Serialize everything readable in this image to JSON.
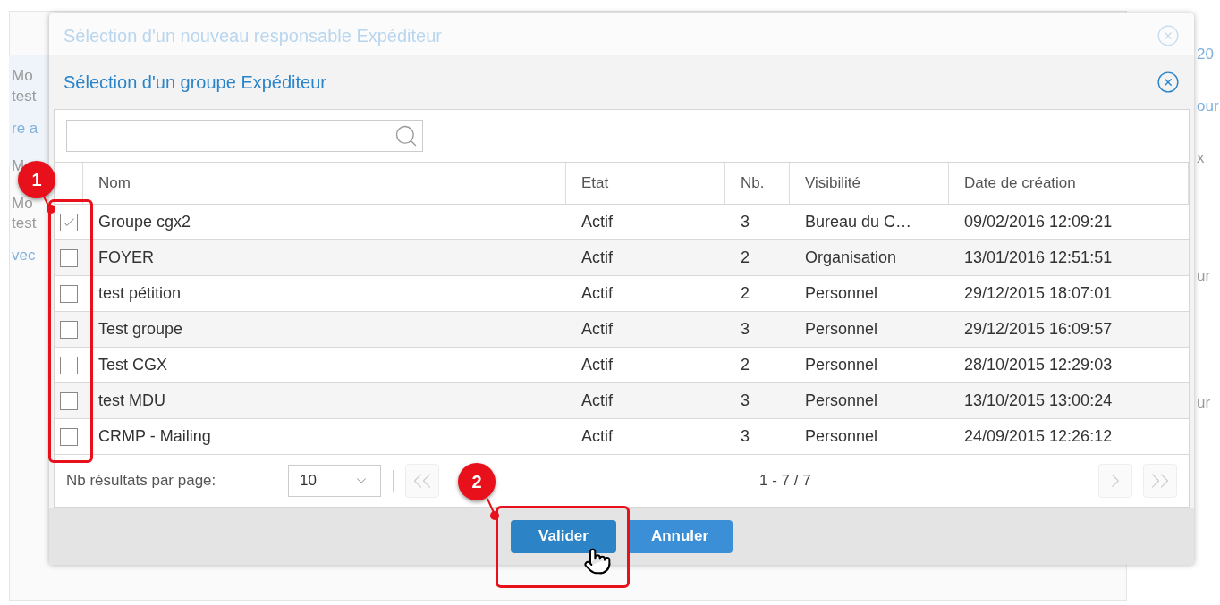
{
  "background": {
    "left_texts": [
      "Mo",
      "test",
      "re a",
      "M",
      "Mo",
      "test",
      "vec"
    ],
    "right_texts": [
      "20",
      "our",
      "x",
      "ur",
      "ur"
    ]
  },
  "back_dialog": {
    "title": "Sélection d'un nouveau responsable Expéditeur"
  },
  "dialog": {
    "title": "Sélection d'un groupe Expéditeur",
    "table": {
      "columns": [
        "Nom",
        "Etat",
        "Nb.",
        "Visibilité",
        "Date de création"
      ],
      "rows": [
        {
          "checked": true,
          "cells": [
            "Groupe cgx2",
            "Actif",
            "3",
            "Bureau du C…",
            "09/02/2016 12:09:21"
          ]
        },
        {
          "checked": false,
          "cells": [
            "FOYER",
            "Actif",
            "2",
            "Organisation",
            "13/01/2016 12:51:51"
          ]
        },
        {
          "checked": false,
          "cells": [
            "test pétition",
            "Actif",
            "2",
            "Personnel",
            "29/12/2015 18:07:01"
          ]
        },
        {
          "checked": false,
          "cells": [
            "Test groupe",
            "Actif",
            "3",
            "Personnel",
            "29/12/2015 16:09:57"
          ]
        },
        {
          "checked": false,
          "cells": [
            "Test CGX",
            "Actif",
            "2",
            "Personnel",
            "28/10/2015 12:29:03"
          ]
        },
        {
          "checked": false,
          "cells": [
            "test MDU",
            "Actif",
            "3",
            "Personnel",
            "13/10/2015 13:00:24"
          ]
        },
        {
          "checked": false,
          "cells": [
            "CRMP - Mailing",
            "Actif",
            "3",
            "Personnel",
            "24/09/2015 12:26:12"
          ]
        }
      ]
    },
    "pagination": {
      "label": "Nb résultats par page:",
      "page_size": "10",
      "range": "1 - 7 / 7"
    },
    "buttons": [
      "Valider",
      "Annuler"
    ]
  },
  "annotations": [
    {
      "label": "1"
    },
    {
      "label": "2"
    }
  ]
}
